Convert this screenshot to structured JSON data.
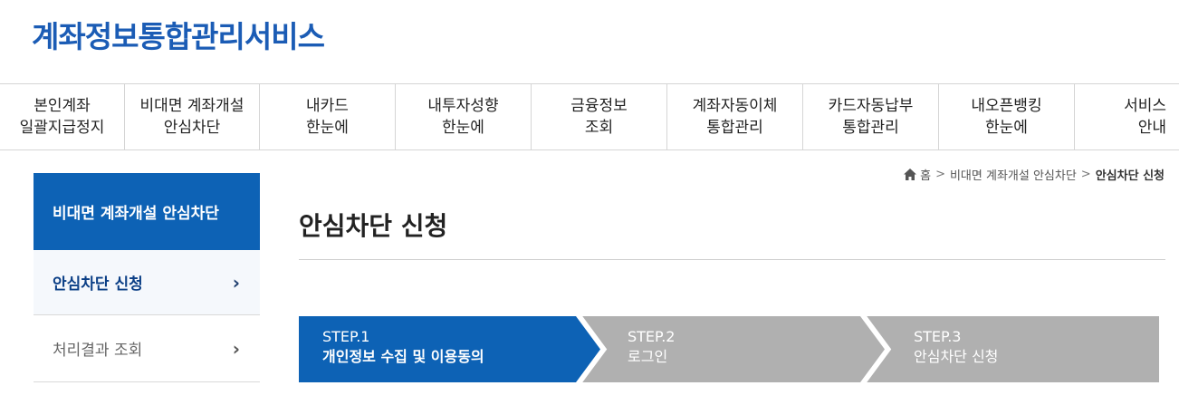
{
  "header": {
    "brand": "계좌정보통합관리서비스"
  },
  "gnb": [
    {
      "line1": "본인계좌",
      "line2": "일괄지급정지"
    },
    {
      "line1": "비대면 계좌개설",
      "line2": "안심차단"
    },
    {
      "line1": "내카드",
      "line2": "한눈에"
    },
    {
      "line1": "내투자성향",
      "line2": "한눈에"
    },
    {
      "line1": "금융정보",
      "line2": "조회"
    },
    {
      "line1": "계좌자동이체",
      "line2": "통합관리"
    },
    {
      "line1": "카드자동납부",
      "line2": "통합관리"
    },
    {
      "line1": "내오픈뱅킹",
      "line2": "한눈에"
    },
    {
      "line1": "서비스",
      "line2": "안내"
    }
  ],
  "lnb": {
    "title": "비대면 계좌개설 안심차단",
    "items": [
      {
        "label": "안심차단 신청",
        "icon": "chevron-right-icon"
      },
      {
        "label": "처리결과 조회",
        "icon": "chevron-right-icon"
      }
    ]
  },
  "breadcrumb": {
    "home": "홈",
    "sep_icon": "chevron-right-icon",
    "items": [
      "비대면 계좌개설 안심차단",
      "안심차단 신청"
    ]
  },
  "main": {
    "title": "안심차단 신청"
  },
  "steps": [
    {
      "num": "STEP.1",
      "label": "개인정보 수집 및 이용동의"
    },
    {
      "num": "STEP.2",
      "label": "로그인"
    },
    {
      "num": "STEP.3",
      "label": "안심차단 신청"
    }
  ],
  "colors": {
    "brand": "#1b5cb5",
    "step_active": "#0d62b5",
    "step_inactive": "#b0b0b0",
    "lnb_title_bg": "#0d62b5"
  }
}
